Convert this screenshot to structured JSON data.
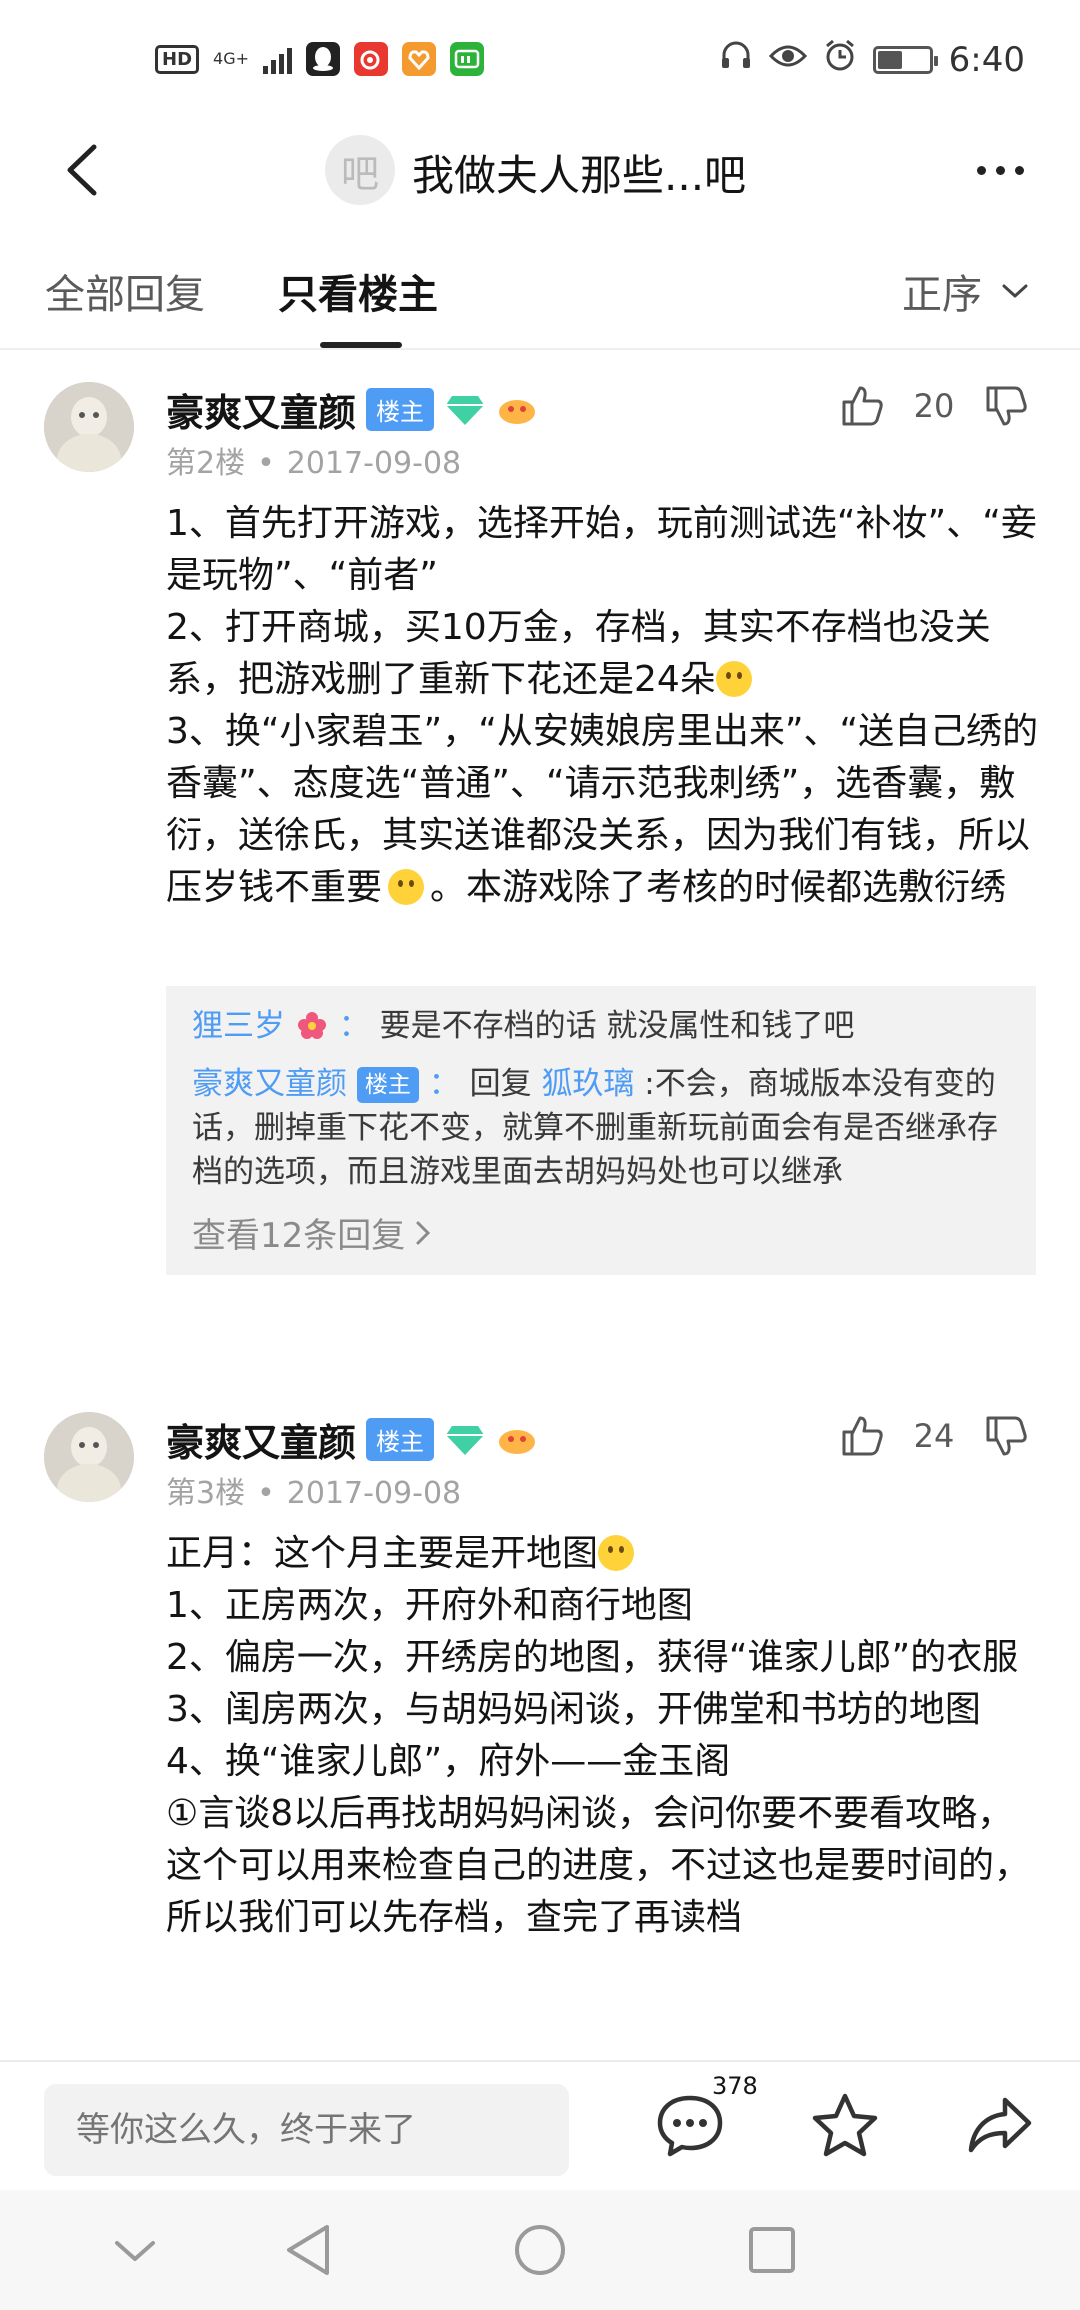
{
  "status_bar": {
    "hd": "HD",
    "signal": "4G+",
    "time": "6:40",
    "battery_level": 0.45,
    "apps": [
      {
        "name": "qq",
        "color": "#222222"
      },
      {
        "name": "weibo",
        "color": "#e8382f"
      },
      {
        "name": "favor",
        "color": "#f59a2e"
      },
      {
        "name": "iqiyi",
        "color": "#2db33a"
      }
    ]
  },
  "title_bar": {
    "avatar_text": "吧",
    "title": "我做夫人那些...吧"
  },
  "tabs": {
    "all": "全部回复",
    "owner_only": "只看楼主",
    "sort": "正序"
  },
  "posts": [
    {
      "author": "豪爽又童颜",
      "badge": "楼主",
      "floor": "第2楼",
      "date": "2017-09-08",
      "likes": "20",
      "paragraphs": [
        "1、首先打开游戏，选择开始，玩前测试选“补妆”、“妾是玩物”、“前者”",
        "2、打开商城，买10万金，存档，其实不存档也没关系，把游戏删了重新下花还是24朵",
        "3、换“小家碧玉”，“从安姨娘房里出来”、“送自己绣的香囊”、态度选“普通”、“请示范我刺绣”，选香囊，敷衍，送徐氏，其实送谁都没关系，因为我们有钱，所以压岁钱不重要",
        "。本游戏除了考核的时候都选敷衍绣"
      ],
      "comments": [
        {
          "name": "狸三岁",
          "sep": "：",
          "text": "要是不存档的话 就没属性和钱了吧"
        },
        {
          "name": "豪爽又童颜",
          "badge": "楼主",
          "sep": "：",
          "reply_prefix": "回复",
          "reply_to": "狐玖璃",
          "text": ":不会，商城版本没有变的话，删掉重下花不变，就算不删重新玩前面会有是否继承存档的选项，而且游戏里面去胡妈妈处也可以继承"
        }
      ],
      "view_more": "查看12条回复"
    },
    {
      "author": "豪爽又童颜",
      "badge": "楼主",
      "floor": "第3楼",
      "date": "2017-09-08",
      "likes": "24",
      "paragraphs": [
        "正月：这个月主要是开地图",
        "1、正房两次，开府外和商行地图",
        "2、偏房一次，开绣房的地图，获得“谁家儿郎”的衣服",
        "3、闺房两次，与胡妈妈闲谈，开佛堂和书坊的地图",
        "4、换“谁家儿郎”，府外——金玉阁",
        "①言谈8以后再找胡妈妈闲谈，会问你要不要看攻略，这个可以用来检查自己的进度，不过这也是要时间的，所以我们可以先存档，查完了再读档"
      ]
    }
  ],
  "bottom_bar": {
    "reply_placeholder": "等你这么久，终于来了",
    "reply_count": "378"
  }
}
